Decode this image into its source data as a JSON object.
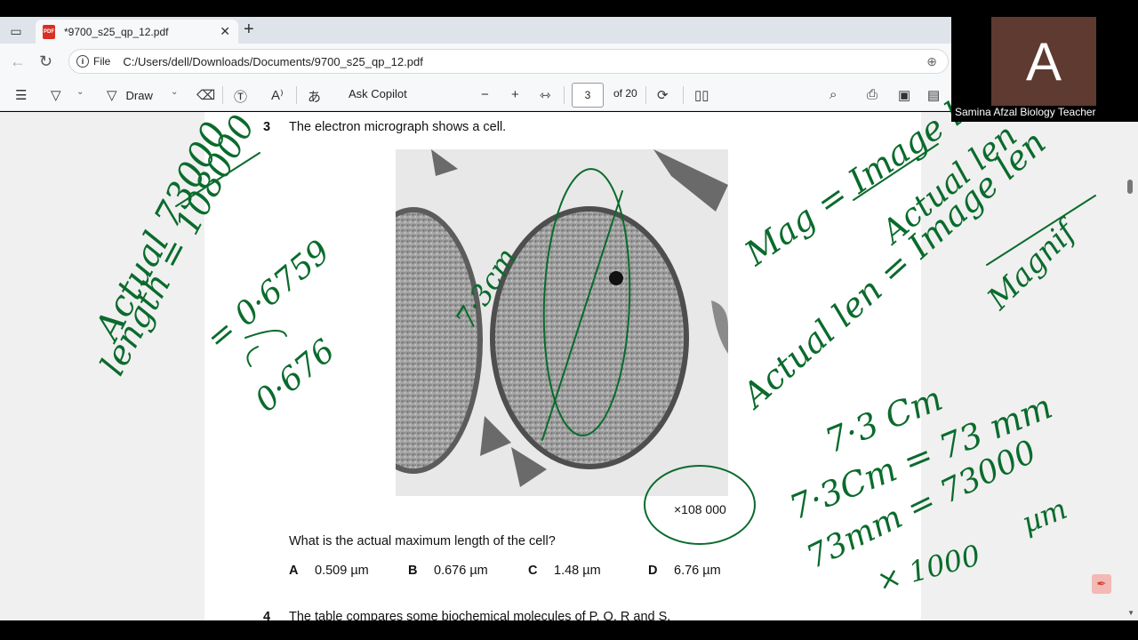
{
  "browser": {
    "tab_title": "*9700_s25_qp_12.pdf",
    "address_scheme": "File",
    "address_url": "C:/Users/dell/Downloads/Documents/9700_s25_qp_12.pdf"
  },
  "toolbar": {
    "draw_label": "Draw",
    "copilot_label": "Ask Copilot",
    "page_current": "3",
    "page_total": "of 20"
  },
  "document": {
    "question_number": "3",
    "question_text": "The electron micrograph shows a cell.",
    "magnification": "×108 000",
    "prompt": "What is the actual maximum length of the cell?",
    "options": [
      {
        "letter": "A",
        "value": "0.509 µm"
      },
      {
        "letter": "B",
        "value": "0.676 µm"
      },
      {
        "letter": "C",
        "value": "1.48 µm"
      },
      {
        "letter": "D",
        "value": "6.76 µm"
      }
    ],
    "next_question_number": "4",
    "next_question_text": "The table compares some biochemical molecules of P, Q, R and S."
  },
  "annotations": {
    "left_note_1": "Actual 73000",
    "left_note_2": "length = 108000",
    "left_note_3": "= 0·6759",
    "left_note_4": "0·676",
    "cell_label": "7·3cm",
    "right_note_1": "Mag = Image len",
    "right_note_2": "Actual len",
    "right_note_3": "Actual len = Image len",
    "right_note_4": "Magnif",
    "right_note_5": "7·3 Cm",
    "right_note_6": "7·3Cm = 73 mm",
    "right_note_7": "73mm = 73000",
    "right_note_8": "µm",
    "right_note_9": "× 1000",
    "ink_color": "#0a6b2c"
  },
  "webcam": {
    "initial": "A",
    "name": "Samina Afzal Biology Teacher"
  }
}
